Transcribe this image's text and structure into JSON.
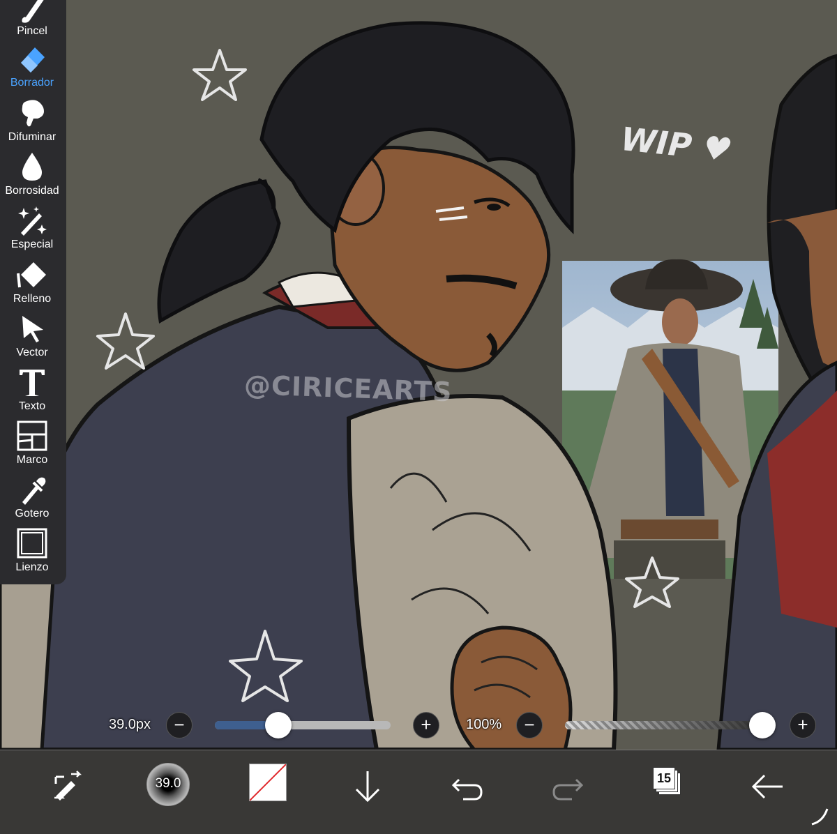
{
  "toolbar": {
    "tools": [
      {
        "label": "Pincel",
        "icon": "brush-icon",
        "active": false
      },
      {
        "label": "Borrador",
        "icon": "eraser-icon",
        "active": true
      },
      {
        "label": "Difuminar",
        "icon": "smudge-icon",
        "active": false
      },
      {
        "label": "Borrosidad",
        "icon": "blur-drop-icon",
        "active": false
      },
      {
        "label": "Especial",
        "icon": "magic-wand-icon",
        "active": false
      },
      {
        "label": "Relleno",
        "icon": "fill-bucket-icon",
        "active": false
      },
      {
        "label": "Vector",
        "icon": "arrow-pointer-icon",
        "active": false
      },
      {
        "label": "Texto",
        "icon": "text-icon",
        "active": false
      },
      {
        "label": "Marco",
        "icon": "frame-divider-icon",
        "active": false
      },
      {
        "label": "Gotero",
        "icon": "eyedropper-icon",
        "active": false
      },
      {
        "label": "Lienzo",
        "icon": "canvas-icon",
        "active": false
      }
    ],
    "active_color": "#4aa3ff"
  },
  "sliders": {
    "size_label": "39.0px",
    "size_value": 0.36,
    "opacity_label": "100%",
    "opacity_value": 1.0,
    "minus": "−",
    "plus": "+"
  },
  "canvas": {
    "watermark": "@CIRICEARTS",
    "note": "WIP ♥"
  },
  "bottombar": {
    "brush_size": "39.0",
    "layer_count": "15"
  }
}
